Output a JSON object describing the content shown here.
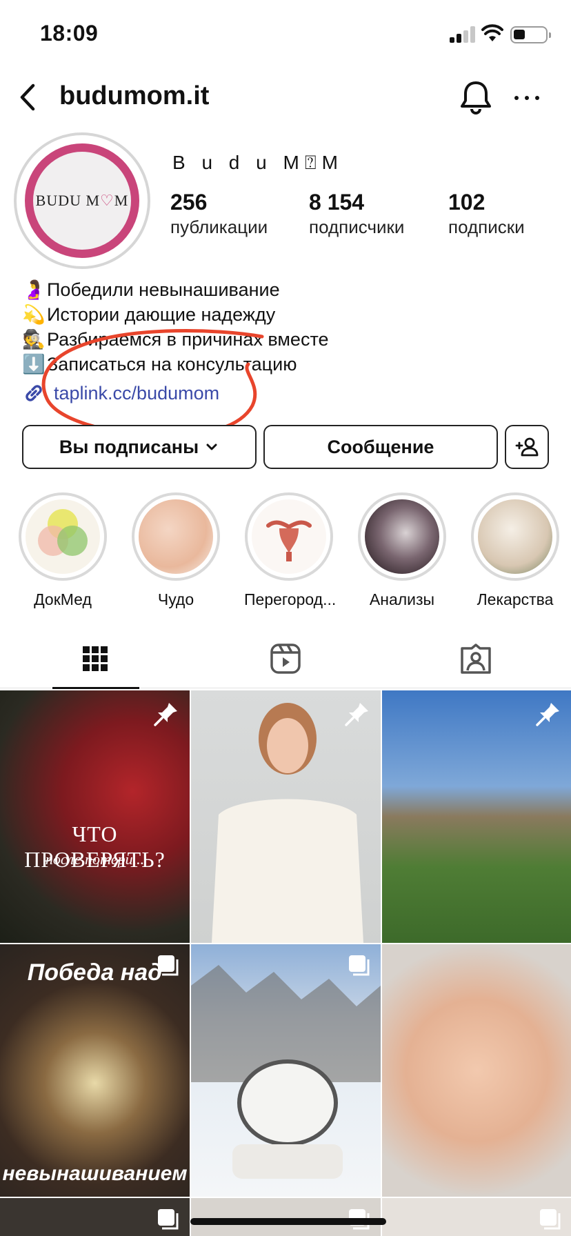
{
  "status": {
    "time": "18:09"
  },
  "header": {
    "username": "budumom.it"
  },
  "profile": {
    "display_name": "B u d u M⍰M",
    "avatar_logo_left": "BUDU M",
    "avatar_logo_heart": "♡",
    "avatar_logo_right": "M",
    "stats": [
      {
        "value": "256",
        "label": "публикации"
      },
      {
        "value": "8 154",
        "label": "подписчики"
      },
      {
        "value": "102",
        "label": "подписки"
      }
    ],
    "bio": [
      {
        "emoji": "🤰",
        "text": "Победили невынашивание"
      },
      {
        "emoji": "💫",
        "text": "Истории дающие надежду"
      },
      {
        "emoji": "🕵",
        "text": "Разбираемся в причинах вместе"
      },
      {
        "emoji": "⬇️",
        "text": "Записаться на консультацию"
      }
    ],
    "link": "taplink.cc/budumom"
  },
  "buttons": {
    "following": "Вы подписаны",
    "message": "Сообщение"
  },
  "highlights": [
    {
      "label": "ДокМед"
    },
    {
      "label": "Чудо"
    },
    {
      "label": "Перегород..."
    },
    {
      "label": "Анализы"
    },
    {
      "label": "Лекарства"
    }
  ],
  "posts": [
    {
      "caption_main": "ЧТО ПРОВЕРЯТЬ?",
      "caption_sub": "после потери..."
    },
    {
      "caption_main": "",
      "caption_sub": ""
    },
    {
      "caption_main": "",
      "caption_sub": ""
    },
    {
      "caption_main": "Победа над",
      "caption_sub": "невынашиванием"
    },
    {
      "caption_main": "",
      "caption_sub": ""
    },
    {
      "caption_main": "",
      "caption_sub": ""
    }
  ],
  "colors": {
    "accent": "#c9457a",
    "link": "#3b4aa8",
    "annotation": "#e8452c"
  }
}
